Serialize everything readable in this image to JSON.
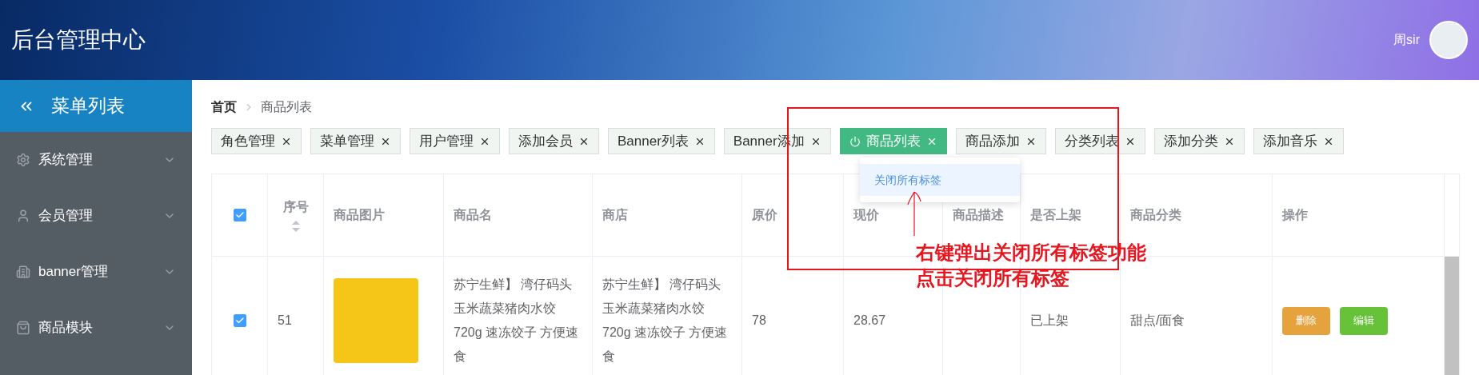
{
  "header": {
    "title": "后台管理中心",
    "user": "周sir"
  },
  "sidebar": {
    "title": "菜单列表",
    "items": [
      {
        "label": "系统管理",
        "expanded": false
      },
      {
        "label": "会员管理",
        "expanded": false
      },
      {
        "label": "banner管理",
        "expanded": false
      },
      {
        "label": "商品模块",
        "expanded": false
      }
    ]
  },
  "breadcrumb": [
    "首页",
    "商品列表"
  ],
  "tags": [
    {
      "label": "角色管理",
      "selected": false
    },
    {
      "label": "菜单管理",
      "selected": false
    },
    {
      "label": "用户管理",
      "selected": false
    },
    {
      "label": "添加会员",
      "selected": false
    },
    {
      "label": "Banner列表",
      "selected": false
    },
    {
      "label": "Banner添加",
      "selected": false
    },
    {
      "label": "商品列表",
      "selected": true
    },
    {
      "label": "商品添加",
      "selected": false
    },
    {
      "label": "分类列表",
      "selected": false
    },
    {
      "label": "添加分类",
      "selected": false
    },
    {
      "label": "添加音乐",
      "selected": false
    }
  ],
  "context_menu": {
    "items": [
      {
        "label": "关闭所有标签",
        "selected": true
      }
    ]
  },
  "table": {
    "all_checked": true,
    "columns": [
      "序号",
      "商品图片",
      "商品名",
      "商店",
      "原价",
      "现价",
      "商品描述",
      "是否上架",
      "商品分类",
      "操作"
    ],
    "rows": [
      {
        "checked": true,
        "id": "51",
        "name": "苏宁生鲜】 湾仔码头玉米蔬菜猪肉水饺720g 速冻饺子 方便速食",
        "shop": "苏宁生鲜】 湾仔码头玉米蔬菜猪肉水饺720g 速冻饺子 方便速食",
        "price": "78",
        "current_price": "28.67",
        "status": "已上架",
        "category": "甜点/面食",
        "actions": [
          {
            "label": "删除",
            "kind": "danger"
          },
          {
            "label": "编辑",
            "kind": "edit"
          }
        ]
      }
    ]
  },
  "annotation": {
    "lines": [
      "右键弹出关闭所有标签功能",
      "点击关闭所有标签"
    ]
  }
}
